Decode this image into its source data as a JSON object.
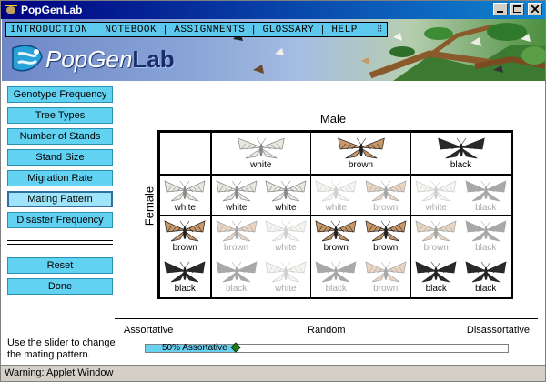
{
  "window": {
    "title": "PopGenLab"
  },
  "menu": {
    "items": [
      "INTRODUCTION",
      "NOTEBOOK",
      "ASSIGNMENTS",
      "GLOSSARY",
      "HELP"
    ]
  },
  "logo": {
    "text_light": "PopGen",
    "text_bold": "Lab"
  },
  "sidebar": {
    "buttons": [
      "Genotype Frequency",
      "Tree Types",
      "Number of Stands",
      "Stand Size",
      "Migration Rate",
      "Mating Pattern",
      "Disaster Frequency"
    ],
    "active": "Mating Pattern",
    "reset_label": "Reset",
    "done_label": "Done"
  },
  "help_text": "Use the slider to change the mating pattern.",
  "matrix": {
    "male_label": "Male",
    "female_label": "Female",
    "colors": {
      "white": "#e8e8e0",
      "brown": "#c89868",
      "black": "#2a2a2a"
    },
    "male_headers": [
      "white",
      "brown",
      "black"
    ],
    "female_headers": [
      "white",
      "brown",
      "black"
    ],
    "cells": [
      [
        [
          "white",
          "white"
        ],
        [
          "white",
          "brown"
        ],
        [
          "white",
          "black"
        ]
      ],
      [
        [
          "brown",
          "white"
        ],
        [
          "brown",
          "brown"
        ],
        [
          "brown",
          "black"
        ]
      ],
      [
        [
          "black",
          "white"
        ],
        [
          "black",
          "brown"
        ],
        [
          "black",
          "black"
        ]
      ]
    ]
  },
  "slider": {
    "left_label": "Assortative",
    "mid_label": "Random",
    "right_label": "Disassortative",
    "value_text": "50% Assortative",
    "value": 0.25
  },
  "status": {
    "text": "Warning: Applet Window"
  }
}
